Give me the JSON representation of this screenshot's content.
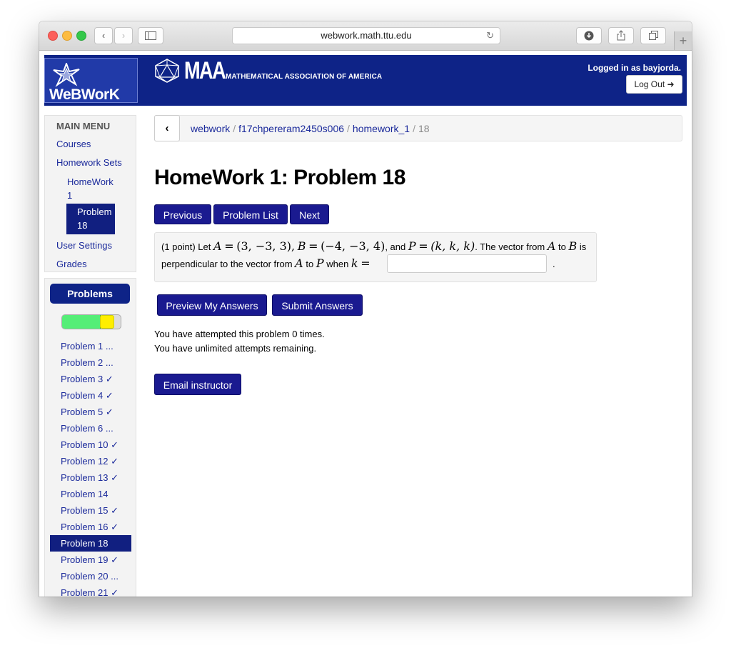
{
  "browser": {
    "url": "webwork.math.ttu.edu"
  },
  "header": {
    "logo_text": "WeBWorK",
    "maa_text": "MAA",
    "maa_subtitle": "MATHEMATICAL ASSOCIATION OF AMERICA",
    "logged_in": "Logged in as bayjorda.",
    "logout_label": "Log Out ➜"
  },
  "menu": {
    "heading": "MAIN MENU",
    "courses": "Courses",
    "homework_sets": "Homework Sets",
    "homework_line1": "HomeWork",
    "homework_line2": "1",
    "problem_line1": "Problem",
    "problem_line2": "18",
    "user_settings": "User Settings",
    "grades": "Grades"
  },
  "problems_panel": {
    "title": "Problems",
    "progress_correct_fraction": 0.65,
    "progress_partial_fraction": 0.22,
    "items": [
      {
        "label": "Problem 1 ...",
        "current": false
      },
      {
        "label": "Problem 2 ...",
        "current": false
      },
      {
        "label": "Problem 3 ✓",
        "current": false
      },
      {
        "label": "Problem 4 ✓",
        "current": false
      },
      {
        "label": "Problem 5 ✓",
        "current": false
      },
      {
        "label": "Problem 6 ...",
        "current": false
      },
      {
        "label": "Problem 10 ✓",
        "current": false
      },
      {
        "label": "Problem 12 ✓",
        "current": false
      },
      {
        "label": "Problem 13 ✓",
        "current": false
      },
      {
        "label": "Problem 14",
        "current": false
      },
      {
        "label": "Problem 15 ✓",
        "current": false
      },
      {
        "label": "Problem 16 ✓",
        "current": false
      },
      {
        "label": "Problem 18",
        "current": true
      },
      {
        "label": "Problem 19 ✓",
        "current": false
      },
      {
        "label": "Problem 20 ...",
        "current": false
      },
      {
        "label": "Problem 21 ✓",
        "current": false
      }
    ]
  },
  "breadcrumb": {
    "items": [
      "webwork",
      "f17chpereram2450s006",
      "homework_1"
    ],
    "current": "18"
  },
  "main": {
    "title": "HomeWork 1: Problem 18",
    "previous": "Previous",
    "problem_list": "Problem List",
    "next": "Next",
    "problem": {
      "points": "(1 point) Let",
      "A": "A",
      "eq": "=",
      "A_val": "(3, −3, 3)",
      "B": "B",
      "B_val": "(−4, −3, 4)",
      "and": ", and",
      "P": "P",
      "P_val": "(k, k, k)",
      "vector_from": ". The vector from",
      "to": "to",
      "is": "is",
      "line2_a": "perpendicular to the vector from",
      "line2_when": "when",
      "k": "k",
      "answer_value": "",
      "dot": "."
    },
    "preview": "Preview My Answers",
    "submit": "Submit Answers",
    "attempted": "You have attempted this problem 0 times.",
    "remaining": "You have unlimited attempts remaining.",
    "email": "Email instructor"
  }
}
